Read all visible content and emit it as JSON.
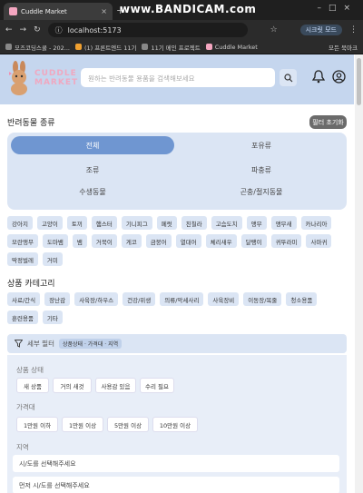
{
  "browser": {
    "tab_title": "Cuddle Market",
    "watermark": "www.BANDICAM.com",
    "url": "localhost:5173",
    "profile_label": "시크릿 모드",
    "bookmarks": [
      "모즈코딩스쿨 - 202...",
      "(1) 프론트엔드 11기",
      "11기 메인 프로젝트",
      "Cuddle Market"
    ],
    "all_bookmarks": "모든 북마크"
  },
  "header": {
    "logo_line1": "CUDDLE",
    "logo_line2": "MARKET",
    "search_placeholder": "원하는 반려동물 용품을 검색해보세요"
  },
  "pet_types": {
    "title": "반려동물 종류",
    "reset_label": "필터 초기화",
    "options": [
      "전체",
      "포유류",
      "조류",
      "파충류",
      "수생동물",
      "곤충/절지동물"
    ]
  },
  "pet_species": [
    "강아지",
    "고양이",
    "토끼",
    "햄스터",
    "기니피그",
    "페럿",
    "친칠라",
    "고슴도치",
    "앵무",
    "앵무새",
    "카나리아",
    "모란앵무",
    "도마뱀",
    "뱀",
    "거북이",
    "게코",
    "금붕어",
    "열대어",
    "체리새우",
    "달팽이",
    "귀뚜라미",
    "사마귀",
    "딱정벌레",
    "거미"
  ],
  "category": {
    "title": "상품 카테고리",
    "options": [
      "사료/간식",
      "장난감",
      "사육장/하우스",
      "건강/위생",
      "의류/악세사리",
      "사육장비",
      "이동장/목줄",
      "청소용품",
      "훈련용품",
      "기타"
    ]
  },
  "detail_filter": {
    "title": "세부 필터",
    "tag": "상품상태 · 가격대 · 지역",
    "condition_label": "상품 상태",
    "conditions": [
      "새 상품",
      "거의 새것",
      "사용감 있음",
      "수리 필요"
    ],
    "price_label": "가격대",
    "prices": [
      "1만원 이하",
      "1만원 이상",
      "5만원 이상",
      "10만원 이상"
    ],
    "region_label": "지역",
    "region_select": "시/도를 선택해주세요",
    "district_select": "먼저 시/도를 선택해주세요"
  }
}
